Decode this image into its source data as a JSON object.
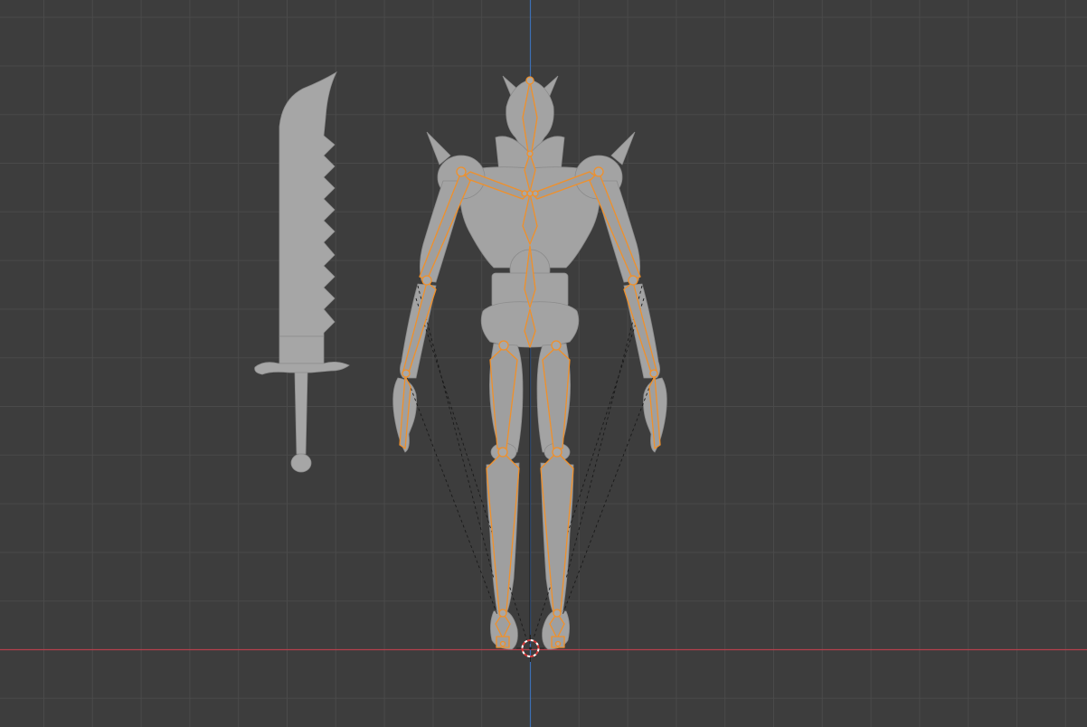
{
  "viewport": {
    "view": "front-orthographic",
    "background_color": "#3d3d3d",
    "grid_color": "#4a4a4a",
    "x_axis_color": "#c4414f",
    "z_axis_color": "#3f78c4",
    "selection_color": "#f0902a",
    "mesh_color": "#a3a3a3"
  },
  "scene": {
    "objects": [
      {
        "name": "sword",
        "kind": "mesh",
        "selected": false
      },
      {
        "name": "character",
        "kind": "mesh",
        "selected": false
      },
      {
        "name": "armature",
        "kind": "armature",
        "selected": true
      }
    ],
    "cursor_3d": "cursor-icon"
  }
}
